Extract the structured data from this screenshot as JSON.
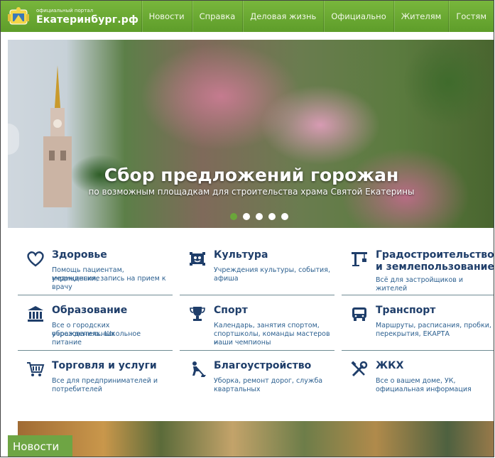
{
  "header": {
    "logo_small": "официальный портал",
    "logo_big": "Екатеринбург.рф",
    "nav": [
      "Новости",
      "Справка",
      "Деловая жизнь",
      "Официально",
      "Жителям",
      "Гостям"
    ]
  },
  "hero": {
    "title": "Сбор предложений горожан",
    "subtitle": "по возможным площадкам для строительства храма Святой Екатерины",
    "slides_total": 5,
    "active_slide": 1
  },
  "categories": [
    {
      "title": "Здоровье",
      "desc": [
        "Помощь пациентам, медицинские",
        "учреждения, запись на прием к",
        "врачу"
      ],
      "icon": "heart-icon"
    },
    {
      "title": "Культура",
      "desc": [
        "Учреждения культуры, события,",
        "афиша"
      ],
      "icon": "theatre-icon"
    },
    {
      "title": "Градостроительство",
      "title2": "и землепользование",
      "desc": [
        "Всё для застройщиков и жителей"
      ],
      "icon": "crane-icon"
    },
    {
      "title": "Образование",
      "desc": [
        "Все о городских образовательных",
        "учреждениях. Школьное питание"
      ],
      "icon": "institution-icon"
    },
    {
      "title": "Спорт",
      "desc": [
        "Календарь, занятия спортом,",
        "спортшколы, команды мастеров и",
        "наши чемпионы"
      ],
      "icon": "trophy-icon"
    },
    {
      "title": "Транспорт",
      "desc": [
        "Маршруты, расписания, пробки,",
        "перекрытия, ЕКАРТА"
      ],
      "icon": "bus-icon"
    },
    {
      "title": "Торговля и услуги",
      "desc": [
        "Все для предпринимателей и",
        "потребителей"
      ],
      "icon": "cart-icon"
    },
    {
      "title": "Благоустройство",
      "desc": [
        "Уборка, ремонт дорог, служба",
        "квартальных"
      ],
      "icon": "worker-icon"
    },
    {
      "title": "ЖКХ",
      "desc": [
        "Все о вашем доме, УК,",
        "официальная информация"
      ],
      "icon": "tools-icon"
    }
  ],
  "news_tab": "Новости",
  "colors": {
    "brand_green": "#6aa63a",
    "title_blue": "#1f3e6a",
    "link_blue": "#2b5f8f"
  }
}
